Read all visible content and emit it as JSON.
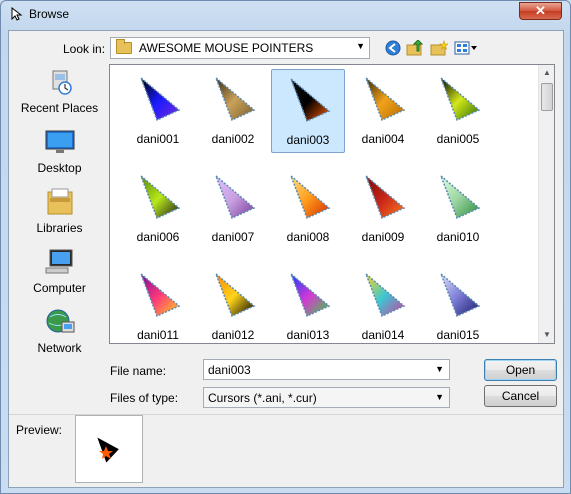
{
  "window": {
    "title": "Browse",
    "close_label": "✕"
  },
  "toolbar": {
    "lookin_label": "Look in:",
    "lookin_value": "AWESOME MOUSE POINTERS"
  },
  "places": [
    {
      "label": "Recent Places",
      "icon": "recent-places-icon"
    },
    {
      "label": "Desktop",
      "icon": "desktop-icon"
    },
    {
      "label": "Libraries",
      "icon": "libraries-icon"
    },
    {
      "label": "Computer",
      "icon": "computer-icon"
    },
    {
      "label": "Network",
      "icon": "network-icon"
    }
  ],
  "files": [
    {
      "name": "dani001",
      "colors": [
        "#1a1aff",
        "#7a2bd9",
        "#000000"
      ]
    },
    {
      "name": "dani002",
      "colors": [
        "#c9a15a",
        "#7a5c2a",
        "#3b2a10"
      ]
    },
    {
      "name": "dani003",
      "colors": [
        "#000000",
        "#ff5a00",
        "#101010"
      ],
      "selected": true
    },
    {
      "name": "dani004",
      "colors": [
        "#f0a21a",
        "#b86a00",
        "#3a2400"
      ]
    },
    {
      "name": "dani005",
      "colors": [
        "#d4e81a",
        "#2a6b00",
        "#000000"
      ]
    },
    {
      "name": "dani006",
      "colors": [
        "#b8e81a",
        "#1a1a1a",
        "#5a8a00"
      ]
    },
    {
      "name": "dani007",
      "colors": [
        "#c8a0e0",
        "#7a3a9a",
        "#e0c0ff"
      ]
    },
    {
      "name": "dani008",
      "colors": [
        "#ff9a1a",
        "#d42a00",
        "#ffe07a"
      ]
    },
    {
      "name": "dani009",
      "colors": [
        "#c8261a",
        "#ff7a1a",
        "#7a0a00"
      ]
    },
    {
      "name": "dani010",
      "colors": [
        "#9ad4a0",
        "#2a8a3a",
        "#e0ffe0"
      ]
    },
    {
      "name": "dani011",
      "colors": [
        "#ff3a7a",
        "#ffd41a",
        "#7a0a9a"
      ]
    },
    {
      "name": "dani012",
      "colors": [
        "#ffd41a",
        "#000000",
        "#ff8a00"
      ]
    },
    {
      "name": "dani013",
      "colors": [
        "#d43ad4",
        "#3ad43a",
        "#1a3aff"
      ]
    },
    {
      "name": "dani014",
      "colors": [
        "#3ac8d4",
        "#d43a9a",
        "#ffd41a"
      ]
    },
    {
      "name": "dani015",
      "colors": [
        "#7a7ad4",
        "#1a1a6a",
        "#e0e0ff"
      ]
    }
  ],
  "form": {
    "filename_label": "File name:",
    "filename_value": "dani003",
    "filetype_label": "Files of type:",
    "filetype_value": "Cursors (*.ani, *.cur)"
  },
  "buttons": {
    "open": "Open",
    "cancel": "Cancel"
  },
  "preview": {
    "label": "Preview:"
  }
}
